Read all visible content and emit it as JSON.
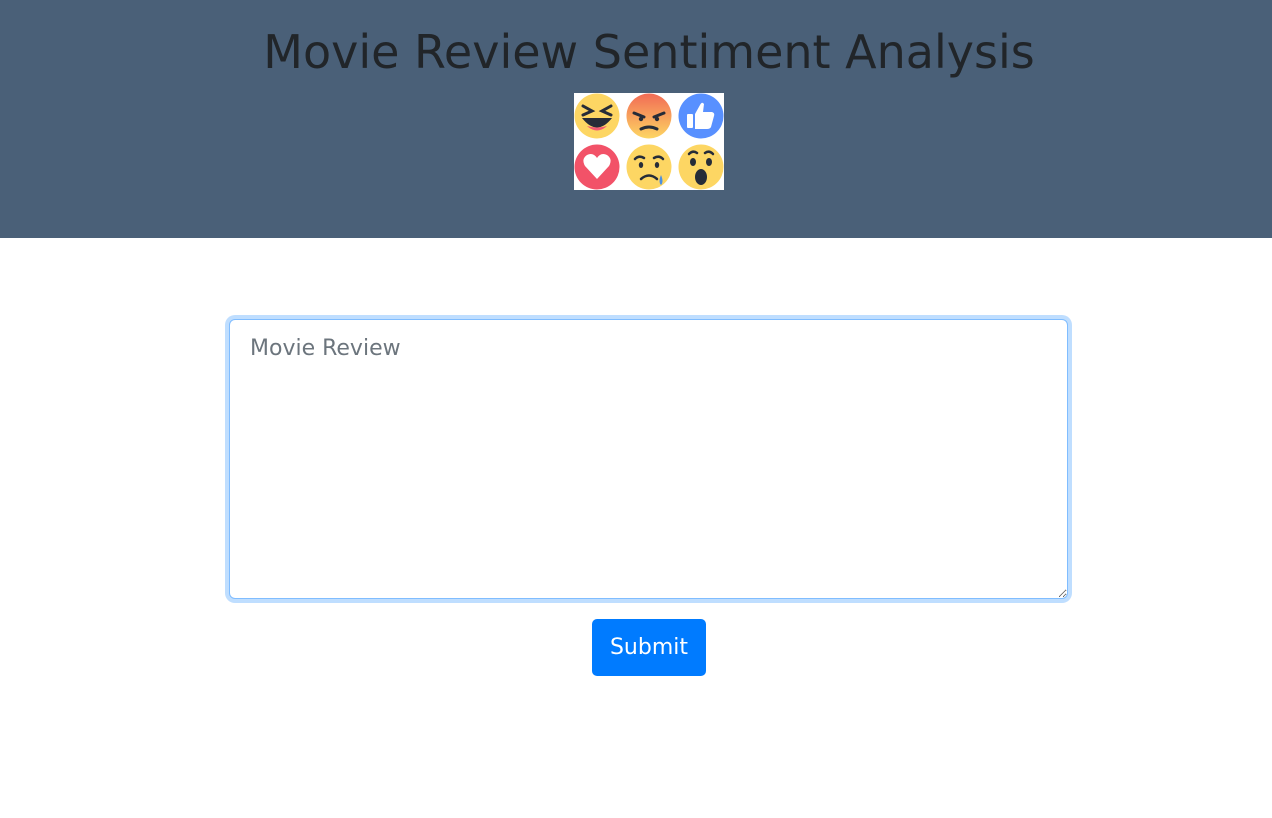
{
  "header": {
    "title": "Movie Review Sentiment Analysis",
    "background_color": "#4a6078",
    "reaction_icons": [
      "laughing-face-icon",
      "angry-face-icon",
      "thumbs-up-icon",
      "heart-icon",
      "crying-face-icon",
      "surprised-face-icon"
    ]
  },
  "form": {
    "review_placeholder": "Movie Review",
    "review_value": "",
    "submit_label": "Submit",
    "accent_color": "#007bff"
  }
}
